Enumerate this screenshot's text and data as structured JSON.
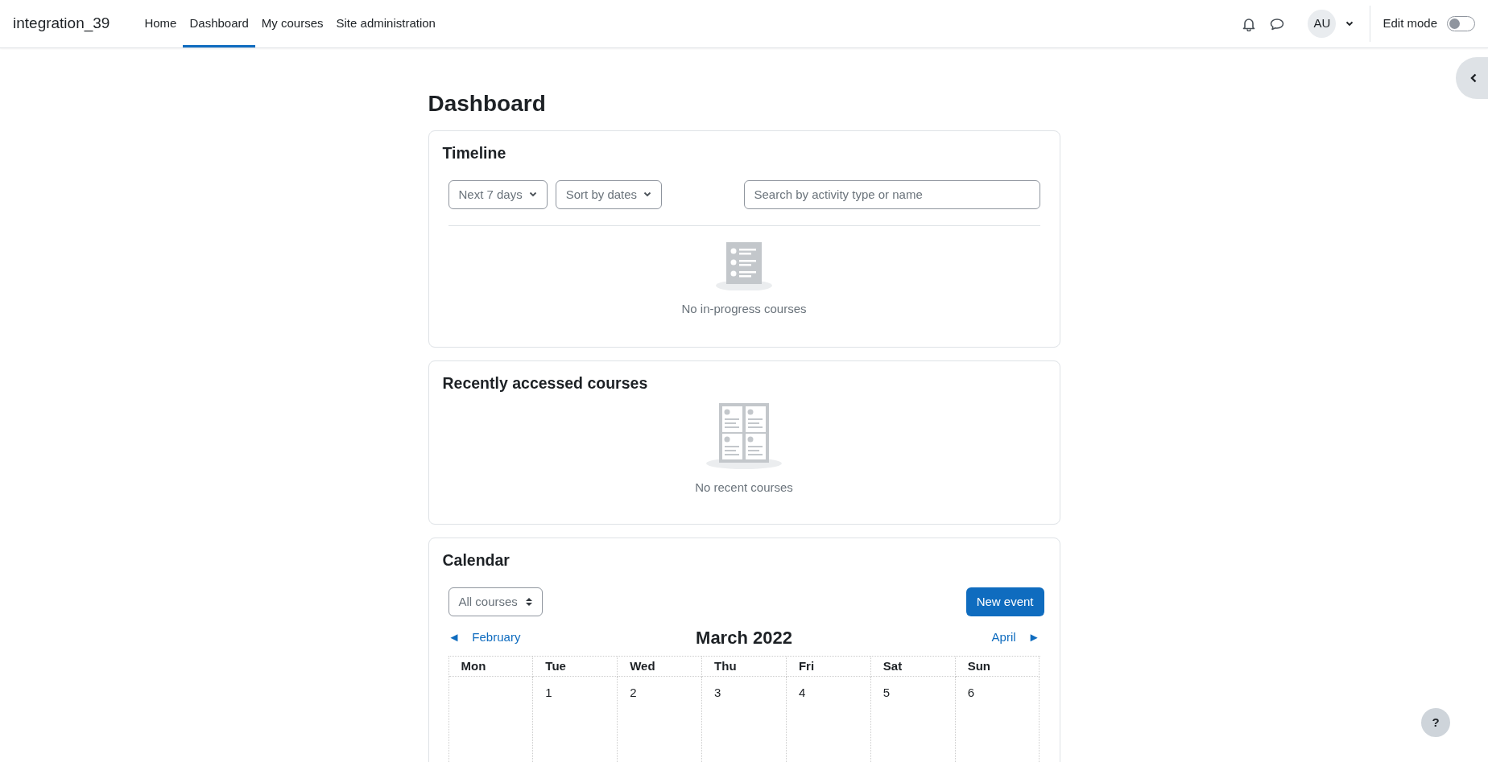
{
  "navbar": {
    "site_name": "integration_39",
    "items": [
      {
        "label": "Home",
        "selected": false
      },
      {
        "label": "Dashboard",
        "selected": true
      },
      {
        "label": "My courses",
        "selected": false
      },
      {
        "label": "Site administration",
        "selected": false
      }
    ],
    "avatar": "AU",
    "edit_mode": {
      "label": "Edit mode",
      "on": false
    }
  },
  "page_title": "Dashboard",
  "timeline": {
    "title": "Timeline",
    "filters": [
      "Next 7 days",
      "Sort by dates"
    ],
    "search": {
      "placeholder": "Search by activity type or name"
    },
    "empty_text": "No in-progress courses"
  },
  "recent_courses": {
    "title": "Recently accessed courses",
    "empty_text": "No recent courses"
  },
  "calendar": {
    "title": "Calendar",
    "course_filter": "All courses",
    "new_event": "New event",
    "prev": {
      "arrow": "◄",
      "label": "February"
    },
    "month": "March 2022",
    "next": {
      "label": "April",
      "arrow": "►"
    },
    "weekdays": [
      "Mon",
      "Tue",
      "Wed",
      "Thu",
      "Fri",
      "Sat",
      "Sun"
    ],
    "weeks": [
      [
        "1",
        "2",
        "3",
        "4",
        "5",
        "6"
      ]
    ]
  },
  "help": "?"
}
